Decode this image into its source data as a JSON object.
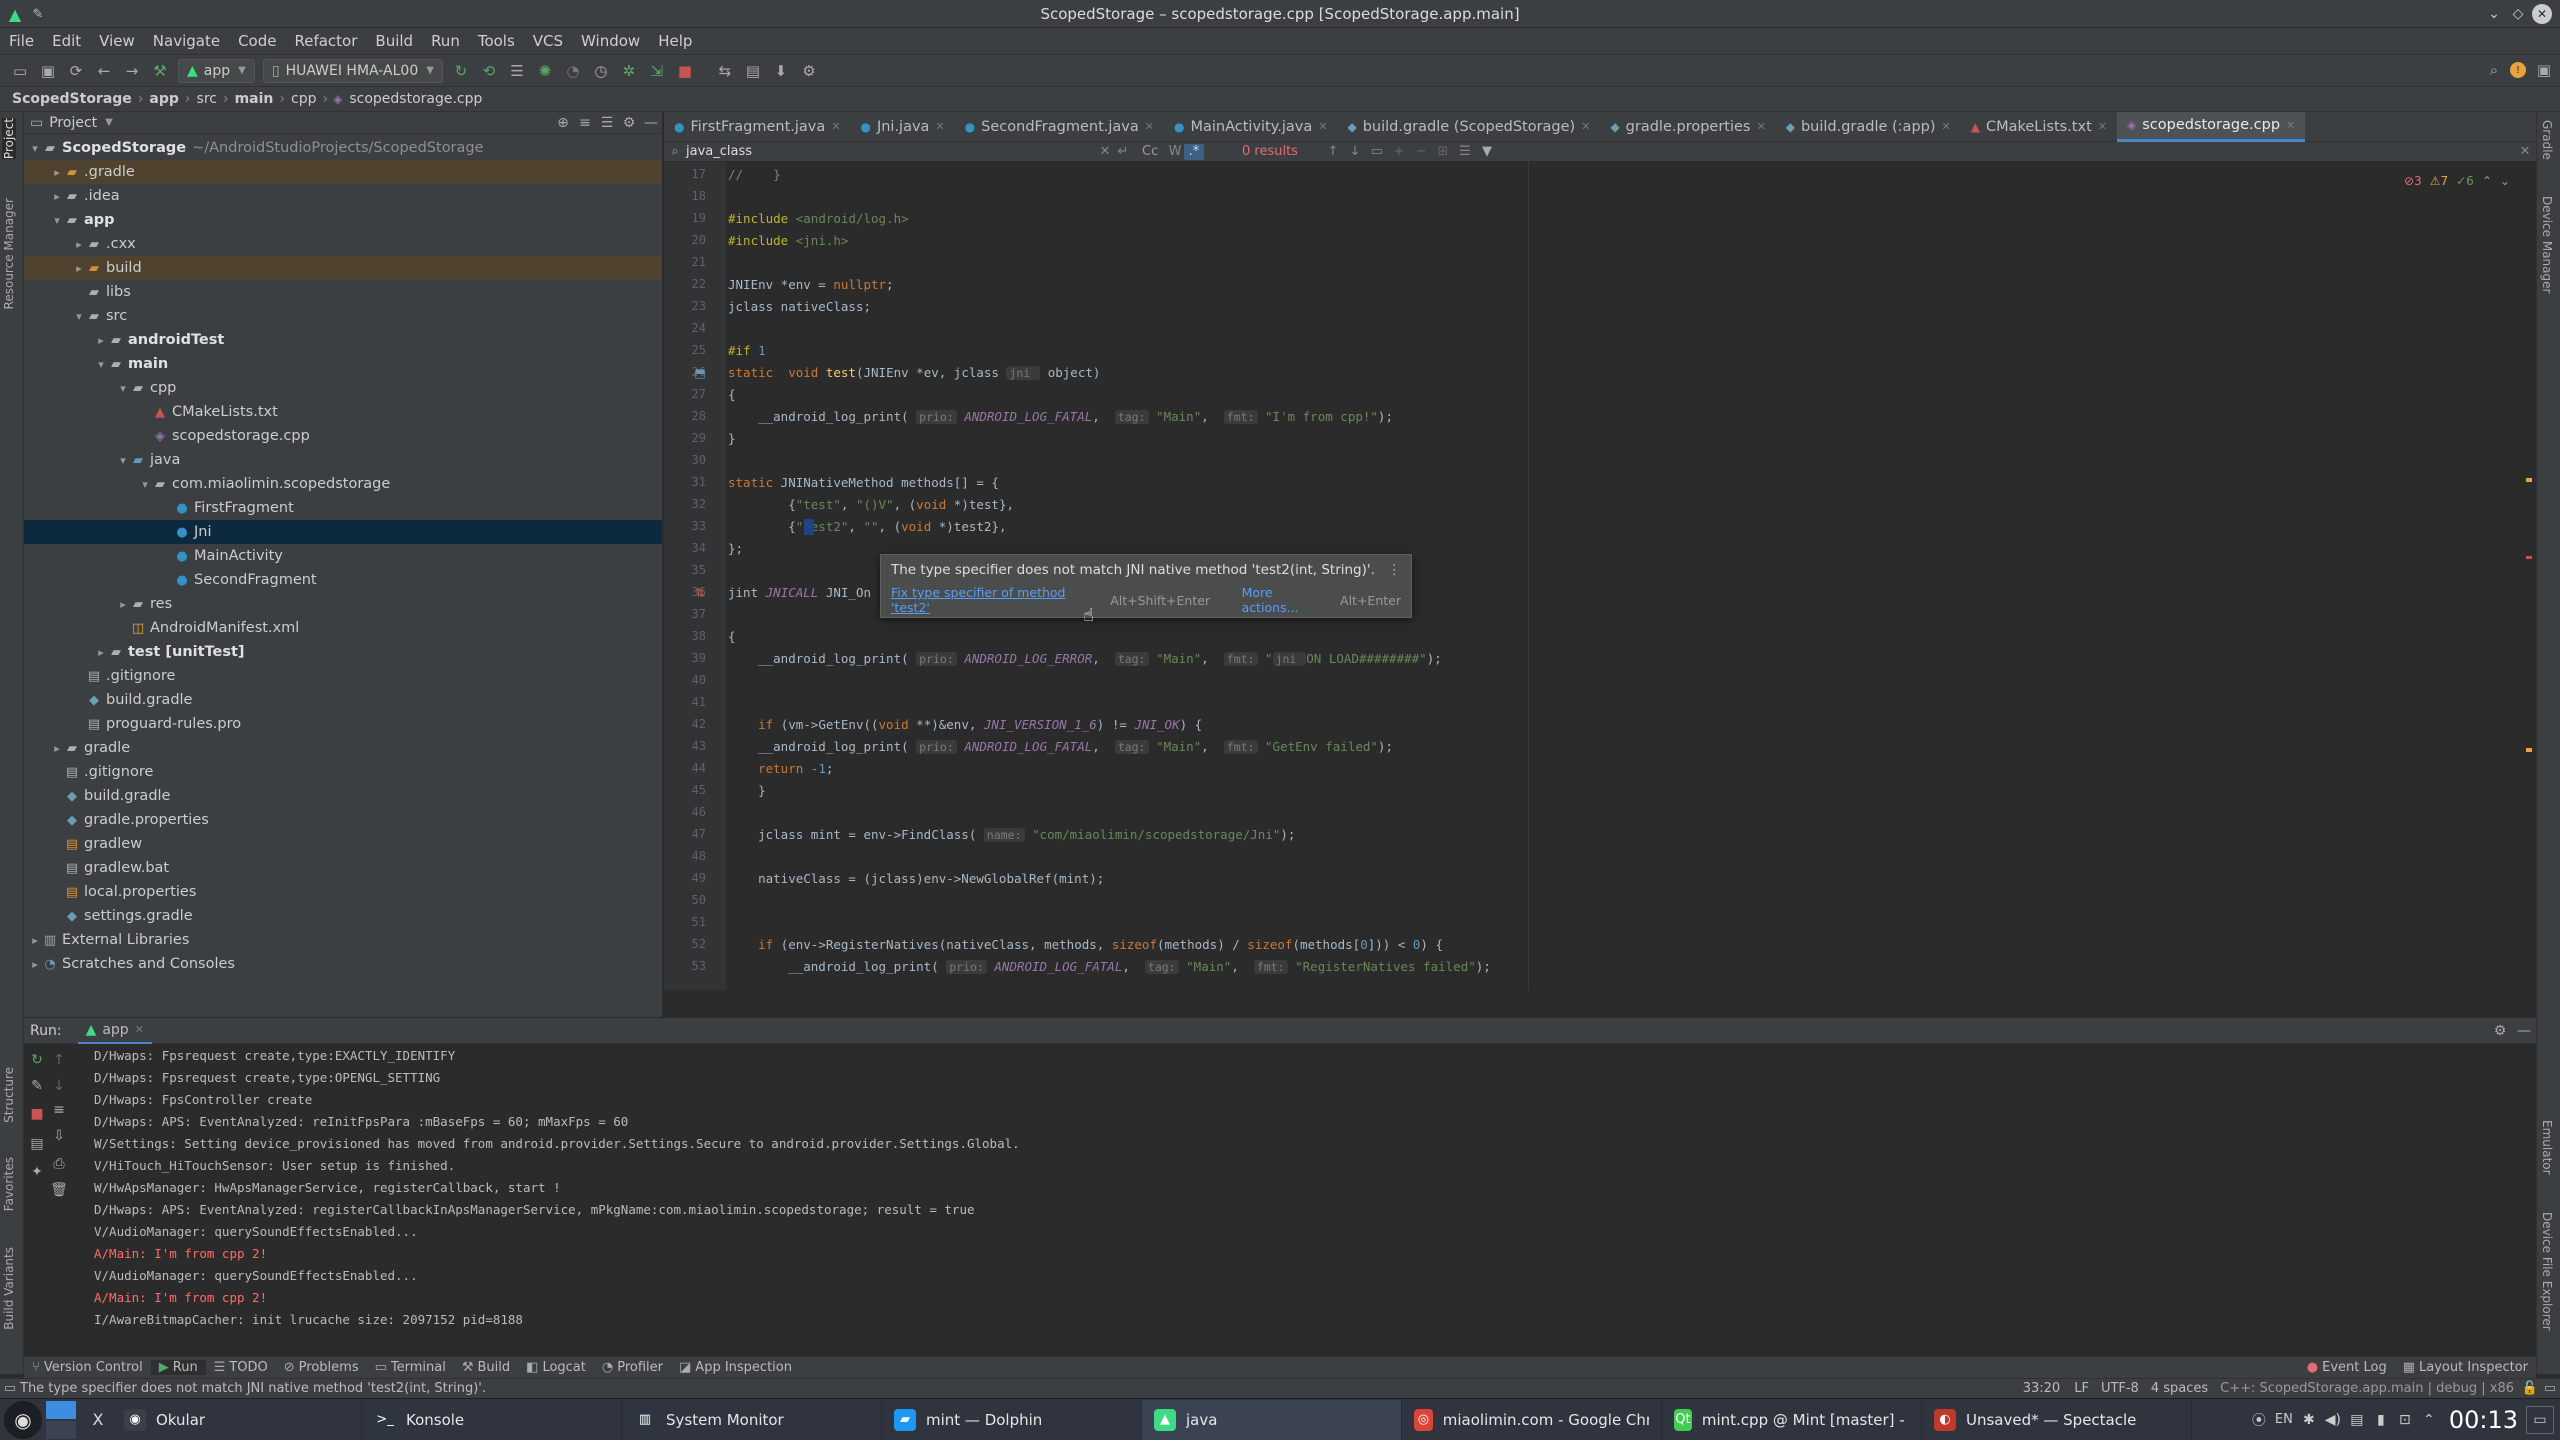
{
  "window": {
    "title": "ScopedStorage – scopedstorage.cpp [ScopedStorage.app.main]"
  },
  "menu": [
    "File",
    "Edit",
    "View",
    "Navigate",
    "Code",
    "Refactor",
    "Build",
    "Run",
    "Tools",
    "VCS",
    "Window",
    "Help"
  ],
  "toolbar": {
    "config": "app",
    "device": "HUAWEI HMA-AL00"
  },
  "breadcrumb": [
    "ScopedStorage",
    "app",
    "src",
    "main",
    "cpp",
    "scopedstorage.cpp"
  ],
  "sidebar_left": {
    "project": "Project",
    "resource_manager": "Resource Manager",
    "structure": "Structure",
    "favorites": "Favorites",
    "build_variants": "Build Variants"
  },
  "sidebar_right": {
    "gradle": "Gradle",
    "device_manager": "Device Manager",
    "emulator": "Emulator",
    "device_file_explorer": "Device File Explorer"
  },
  "project": {
    "header": "Project",
    "tree": [
      {
        "label": "ScopedStorage",
        "bold": true,
        "dim": "~/AndroidStudioProjects/ScopedStorage",
        "level": 0,
        "arrow": "▾",
        "icon": "folder",
        "style": ""
      },
      {
        "label": ".gradle",
        "level": 1,
        "arrow": "▸",
        "icon": "folder-orange",
        "style": "hl"
      },
      {
        "label": ".idea",
        "level": 1,
        "arrow": "▸",
        "icon": "folder",
        "style": ""
      },
      {
        "label": "app",
        "bold": true,
        "level": 1,
        "arrow": "▾",
        "icon": "folder",
        "style": ""
      },
      {
        "label": ".cxx",
        "level": 2,
        "arrow": "▸",
        "icon": "folder",
        "style": ""
      },
      {
        "label": "build",
        "level": 2,
        "arrow": "▸",
        "icon": "folder-orange",
        "style": "hl"
      },
      {
        "label": "libs",
        "level": 2,
        "arrow": "",
        "icon": "folder",
        "style": ""
      },
      {
        "label": "src",
        "level": 2,
        "arrow": "▾",
        "icon": "folder",
        "style": ""
      },
      {
        "label": "androidTest",
        "bold": true,
        "level": 3,
        "arrow": "▸",
        "icon": "folder",
        "style": ""
      },
      {
        "label": "main",
        "bold": true,
        "level": 3,
        "arrow": "▾",
        "icon": "folder",
        "style": ""
      },
      {
        "label": "cpp",
        "level": 4,
        "arrow": "▾",
        "icon": "folder",
        "style": ""
      },
      {
        "label": "CMakeLists.txt",
        "level": 5,
        "arrow": "",
        "icon": "cmake",
        "style": ""
      },
      {
        "label": "scopedstorage.cpp",
        "level": 5,
        "arrow": "",
        "icon": "cpp",
        "style": ""
      },
      {
        "label": "java",
        "level": 4,
        "arrow": "▾",
        "icon": "folder-blue",
        "style": ""
      },
      {
        "label": "com.miaolimin.scopedstorage",
        "level": 5,
        "arrow": "▾",
        "icon": "folder",
        "style": ""
      },
      {
        "label": "FirstFragment",
        "level": 6,
        "arrow": "",
        "icon": "class",
        "style": ""
      },
      {
        "label": "Jni",
        "level": 6,
        "arrow": "",
        "icon": "class",
        "style": "sel"
      },
      {
        "label": "MainActivity",
        "level": 6,
        "arrow": "",
        "icon": "class",
        "style": ""
      },
      {
        "label": "SecondFragment",
        "level": 6,
        "arrow": "",
        "icon": "class",
        "style": ""
      },
      {
        "label": "res",
        "level": 4,
        "arrow": "▸",
        "icon": "folder",
        "style": ""
      },
      {
        "label": "AndroidManifest.xml",
        "level": 4,
        "arrow": "",
        "icon": "xml",
        "style": ""
      },
      {
        "label": "test [unitTest]",
        "bold": true,
        "level": 3,
        "arrow": "▸",
        "icon": "folder",
        "style": ""
      },
      {
        "label": ".gitignore",
        "level": 2,
        "arrow": "",
        "icon": "file",
        "style": ""
      },
      {
        "label": "build.gradle",
        "level": 2,
        "arrow": "",
        "icon": "gradle",
        "style": ""
      },
      {
        "label": "proguard-rules.pro",
        "level": 2,
        "arrow": "",
        "icon": "file",
        "style": ""
      },
      {
        "label": "gradle",
        "level": 1,
        "arrow": "▸",
        "icon": "folder",
        "style": ""
      },
      {
        "label": ".gitignore",
        "level": 1,
        "arrow": "",
        "icon": "file",
        "style": ""
      },
      {
        "label": "build.gradle",
        "level": 1,
        "arrow": "",
        "icon": "gradle",
        "style": ""
      },
      {
        "label": "gradle.properties",
        "level": 1,
        "arrow": "",
        "icon": "gradle",
        "style": ""
      },
      {
        "label": "gradlew",
        "level": 1,
        "arrow": "",
        "icon": "file-orange",
        "style": ""
      },
      {
        "label": "gradlew.bat",
        "level": 1,
        "arrow": "",
        "icon": "file",
        "style": ""
      },
      {
        "label": "local.properties",
        "level": 1,
        "arrow": "",
        "icon": "file-orange",
        "style": ""
      },
      {
        "label": "settings.gradle",
        "level": 1,
        "arrow": "",
        "icon": "gradle",
        "style": ""
      },
      {
        "label": "External Libraries",
        "level": 0,
        "arrow": "▸",
        "icon": "lib",
        "style": ""
      },
      {
        "label": "Scratches and Consoles",
        "level": 0,
        "arrow": "▸",
        "icon": "scratch",
        "style": ""
      }
    ]
  },
  "tabs": [
    {
      "label": "FirstFragment.java",
      "icon": "class",
      "active": false
    },
    {
      "label": "Jni.java",
      "icon": "class",
      "active": false
    },
    {
      "label": "SecondFragment.java",
      "icon": "class",
      "active": false
    },
    {
      "label": "MainActivity.java",
      "icon": "class",
      "active": false
    },
    {
      "label": "build.gradle (ScopedStorage)",
      "icon": "gradle",
      "active": false
    },
    {
      "label": "gradle.properties",
      "icon": "gradle",
      "active": false
    },
    {
      "label": "build.gradle (:app)",
      "icon": "gradle",
      "active": false
    },
    {
      "label": "CMakeLists.txt",
      "icon": "cmake",
      "active": false
    },
    {
      "label": "scopedstorage.cpp",
      "icon": "cpp",
      "active": true
    }
  ],
  "find": {
    "query": "java_class",
    "case": "Cc",
    "results": "0 results"
  },
  "inspections": {
    "errors": "3",
    "warnings": "7",
    "ok": "6"
  },
  "editor": {
    "line_numbers": [
      "17",
      "18",
      "19",
      "20",
      "21",
      "22",
      "23",
      "24",
      "25",
      "26",
      "27",
      "28",
      "29",
      "30",
      "31",
      "32",
      "33",
      "34",
      "35",
      "36",
      "37",
      "38",
      "39",
      "40",
      "41",
      "42",
      "43",
      "44",
      "45",
      "46",
      "47",
      "48",
      "49",
      "50",
      "51",
      "52",
      "53"
    ],
    "lines": [
      "//    }",
      "",
      "#include <android/log.h>",
      "#include <jni.h>",
      "",
      "JNIEnv *env = nullptr;",
      "jclass nativeClass;",
      "",
      "#if 1",
      "static  void test(JNIEnv *ev, jclass jni  object)",
      "{",
      "    __android_log_print( prio: ANDROID_LOG_FATAL,  tag: \"Main\",  fmt: \"I'm from cpp!\");",
      "}",
      "",
      "static JNINativeMethod methods[] = {",
      "        {\"test\", \"()V\", (void *)test},",
      "        {\"test2\", \"\", (void *)test2},",
      "};",
      "",
      "jint JNICALL JNI_On",
      "",
      "{",
      "    __android_log_print( prio: ANDROID_LOG_ERROR,  tag: \"Main\",  fmt: \"jni ON LOAD########\");",
      "",
      "",
      "    if (vm->GetEnv((void **)&env, JNI_VERSION_1_6) != JNI_OK) {",
      "    __android_log_print( prio: ANDROID_LOG_FATAL,  tag: \"Main\",  fmt: \"GetEnv failed\");",
      "    return -1;",
      "    }",
      "",
      "    jclass mint = env->FindClass( name: \"com/miaolimin/scopedstorage/Jni\");",
      "",
      "    nativeClass = (jclass)env->NewGlobalRef(mint);",
      "",
      "",
      "    if (env->RegisterNatives(nativeClass, methods, sizeof(methods) / sizeof(methods[0])) < 0) {",
      "        __android_log_print( prio: ANDROID_LOG_FATAL,  tag: \"Main\",  fmt: \"RegisterNatives failed\");"
    ]
  },
  "popup": {
    "message": "The type specifier does not match JNI native method 'test2(int, String)'.",
    "fix_link": "Fix type specifier of method 'test2'",
    "fix_shortcut": "Alt+Shift+Enter",
    "more_actions": "More actions...",
    "more_shortcut": "Alt+Enter"
  },
  "run": {
    "label": "Run:",
    "config": "app",
    "log": [
      {
        "text": "D/Hwaps: Fpsrequest create,type:EXACTLY_IDENTIFY",
        "err": false
      },
      {
        "text": "D/Hwaps: Fpsrequest create,type:OPENGL_SETTING",
        "err": false
      },
      {
        "text": "D/Hwaps: FpsController create",
        "err": false
      },
      {
        "text": "D/Hwaps: APS: EventAnalyzed: reInitFpsPara :mBaseFps = 60; mMaxFps = 60",
        "err": false
      },
      {
        "text": "W/Settings: Setting device_provisioned has moved from android.provider.Settings.Secure to android.provider.Settings.Global.",
        "err": false
      },
      {
        "text": "V/HiTouch_HiTouchSensor: User setup is finished.",
        "err": false
      },
      {
        "text": "W/HwApsManager: HwApsManagerService, registerCallback, start !",
        "err": false
      },
      {
        "text": "D/Hwaps: APS: EventAnalyzed: registerCallbackInApsManagerService, mPkgName:com.miaolimin.scopedstorage; result = true",
        "err": false
      },
      {
        "text": "V/AudioManager: querySoundEffectsEnabled...",
        "err": false
      },
      {
        "text": "A/Main: I'm from cpp 2!",
        "err": true
      },
      {
        "text": "V/AudioManager: querySoundEffectsEnabled...",
        "err": false
      },
      {
        "text": "A/Main: I'm from cpp 2!",
        "err": true
      },
      {
        "text": "I/AwareBitmapCacher: init lrucache size: 2097152 pid=8188",
        "err": false
      }
    ]
  },
  "bottom_tools": [
    {
      "label": "Version Control",
      "icon": "vcs-icon"
    },
    {
      "label": "Run",
      "icon": "play-icon"
    },
    {
      "label": "TODO",
      "icon": "list-icon"
    },
    {
      "label": "Problems",
      "icon": "problems-icon"
    },
    {
      "label": "Terminal",
      "icon": "terminal-icon"
    },
    {
      "label": "Build",
      "icon": "hammer-icon"
    },
    {
      "label": "Logcat",
      "icon": "logcat-icon"
    },
    {
      "label": "Profiler",
      "icon": "profiler-icon"
    },
    {
      "label": "App Inspection",
      "icon": "inspection-icon"
    }
  ],
  "bottom_right_tools": [
    {
      "label": "Event Log"
    },
    {
      "label": "Layout Inspector"
    }
  ],
  "status": {
    "message": "The type specifier does not match JNI native method 'test2(int, String)'.",
    "position": "33:20",
    "line_sep": "LF",
    "encoding": "UTF-8",
    "indent": "4 spaces",
    "context": "C++: ScopedStorage.app.main | debug | x86"
  },
  "taskbar": {
    "tasks": [
      {
        "label": "Okular",
        "icon": "okular-icon",
        "color": "#3a3f4a",
        "active": false
      },
      {
        "label": "Konsole",
        "icon": "konsole-icon",
        "color": "#2e3440",
        "active": false
      },
      {
        "label": "System Monitor",
        "icon": "system-monitor-icon",
        "color": "#2e3440",
        "active": false
      },
      {
        "label": "mint — Dolphin",
        "icon": "dolphin-icon",
        "color": "#1d99f3",
        "active": false
      },
      {
        "label": "java",
        "icon": "android-studio-icon",
        "color": "#3ddc84",
        "active": true
      },
      {
        "label": "miaolimin.com - Google Chrome",
        "icon": "chrome-icon",
        "color": "#db4437",
        "active": false
      },
      {
        "label": "mint.cpp @ Mint [master] - Qt C...",
        "icon": "qtcreator-icon",
        "color": "#41cd52",
        "active": false
      },
      {
        "label": "Unsaved* — Spectacle",
        "icon": "spectacle-icon",
        "color": "#c0392b",
        "active": false
      }
    ],
    "tray_lang": "EN",
    "clock": "00:13"
  },
  "colors": {
    "accent": "#4a88c7",
    "error": "#ff6b68",
    "selection": "#0d293e"
  }
}
